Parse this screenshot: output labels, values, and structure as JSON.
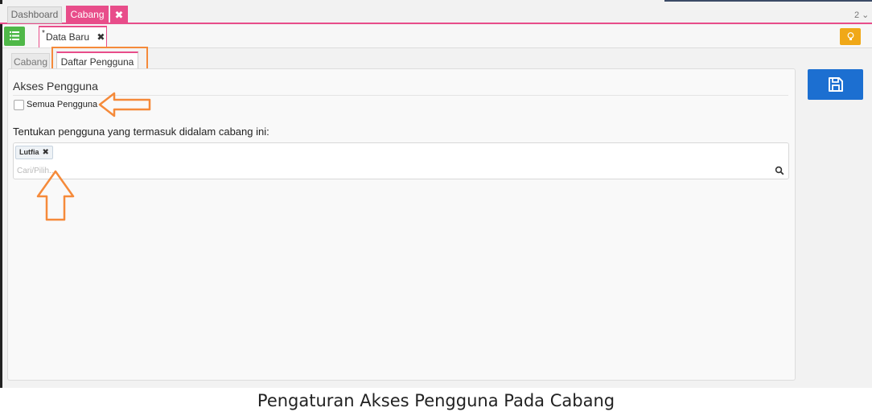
{
  "top_tabs": {
    "dashboard": "Dashboard",
    "cabang": "Cabang",
    "close_symbol": "✖",
    "right_indicator": "2 ⌄"
  },
  "doc_tab": {
    "star": "*",
    "label": "Data Baru",
    "close_symbol": "✖"
  },
  "inner_tabs": {
    "cabang": "Cabang",
    "daftar": "Daftar Pengguna"
  },
  "section": {
    "title": "Akses Pengguna",
    "checkbox_label": "Semua Pengguna",
    "checkbox_checked": false,
    "instruction": "Tentukan pengguna yang termasuk didalam cabang ini:"
  },
  "select": {
    "tags": [
      "Lutfia"
    ],
    "tag_remove_symbol": "✖",
    "placeholder": "Cari/Pilih..."
  },
  "icons": {
    "menu": "list-icon",
    "bulb": "lightbulb-icon",
    "save": "save-icon",
    "search": "search-icon"
  },
  "colors": {
    "accent": "#e84d8a",
    "menu_button": "#4fb848",
    "bulb_button": "#f0a818",
    "save_button": "#1c6fd1",
    "annotation": "#f58a3a"
  },
  "caption": "Pengaturan Akses Pengguna Pada Cabang"
}
